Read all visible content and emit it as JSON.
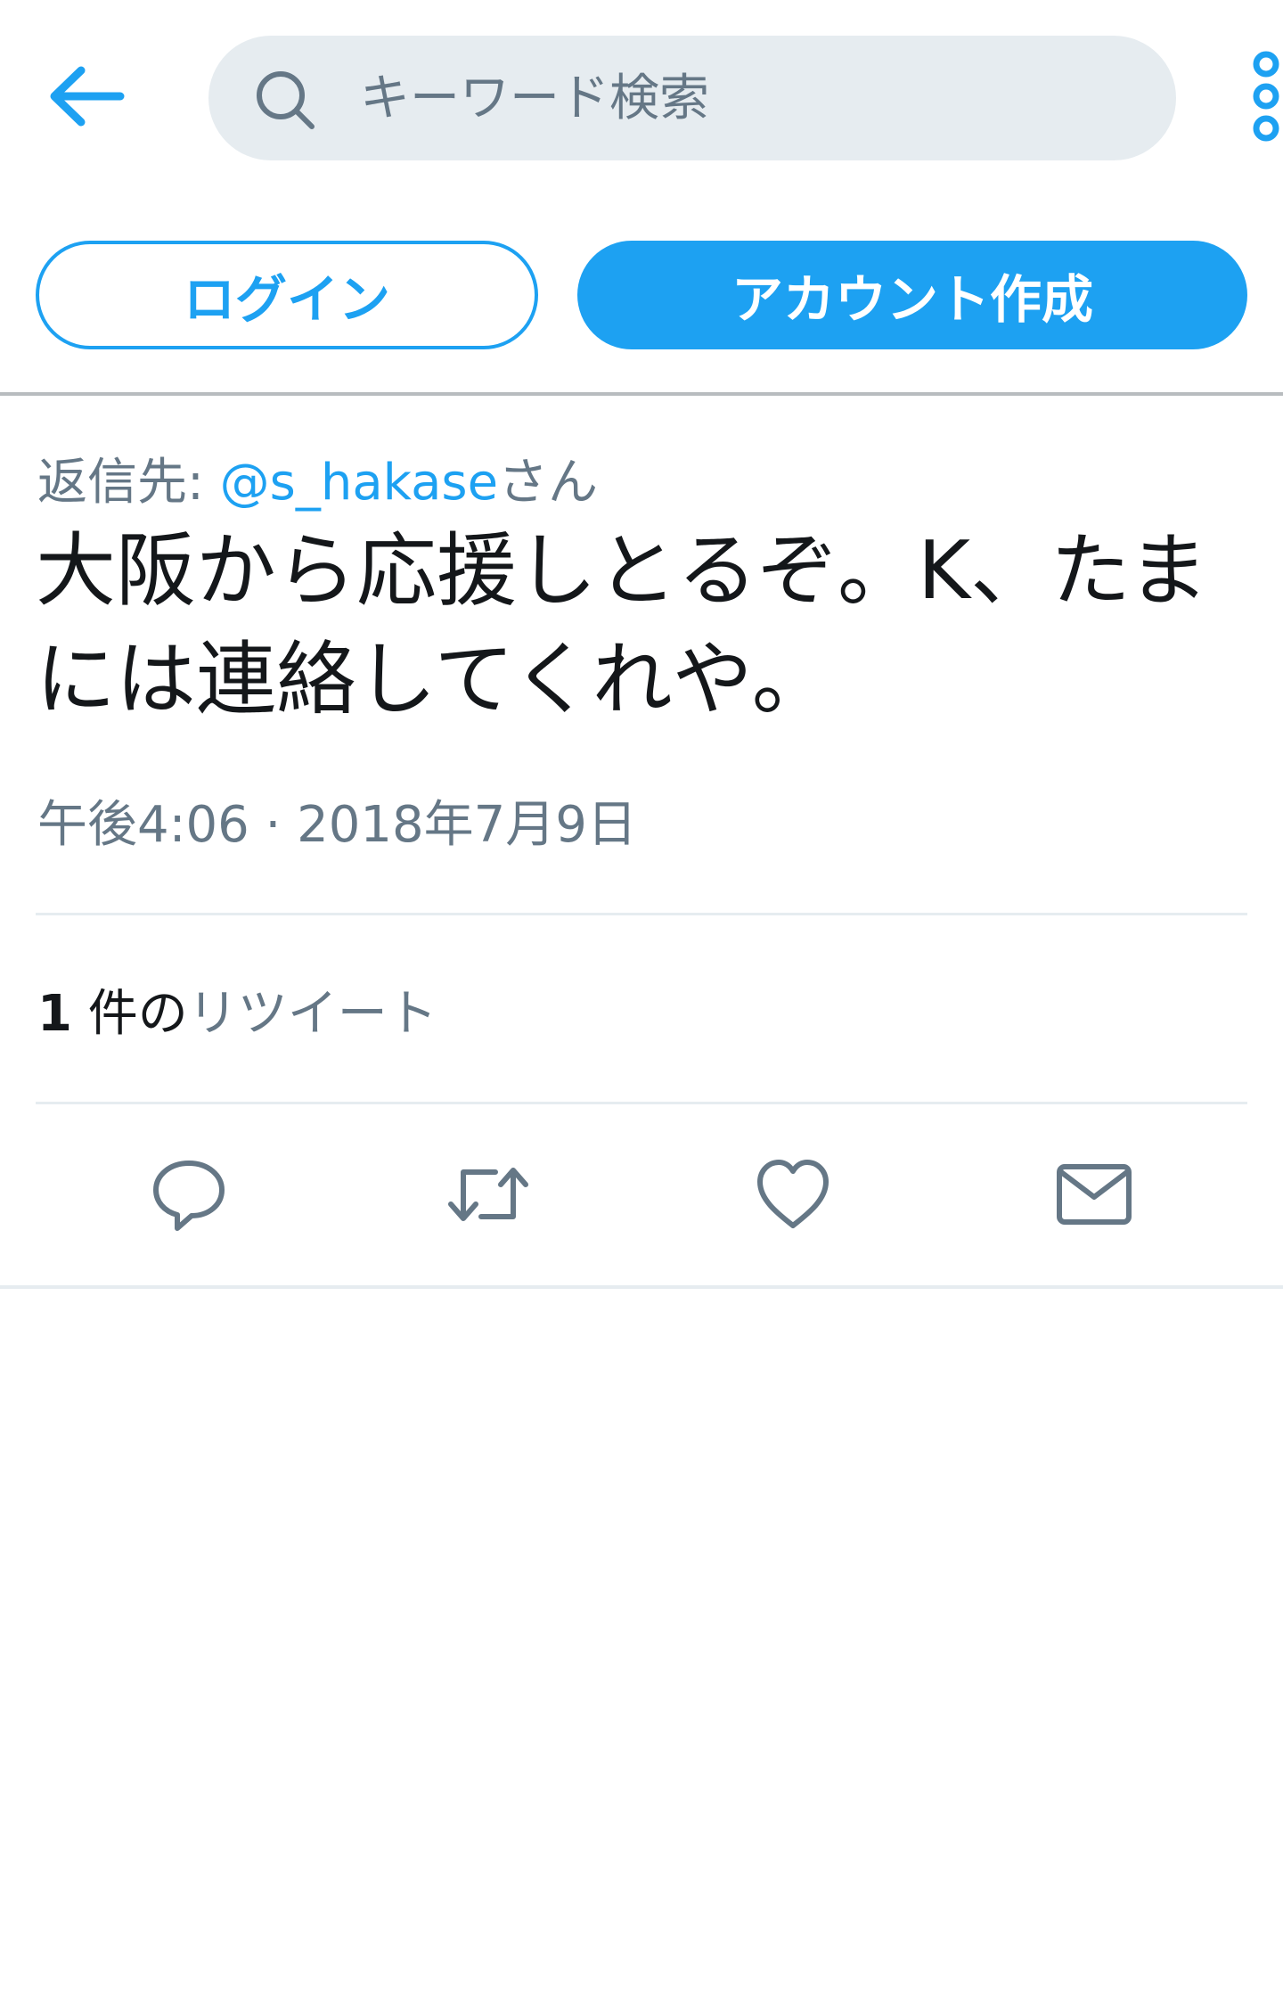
{
  "header": {
    "search": {
      "placeholder": "キーワード検索",
      "value": ""
    },
    "icons": {
      "back": "arrow-left-icon",
      "search": "search-icon",
      "more": "more-vertical-icon"
    }
  },
  "auth": {
    "login_label": "ログイン",
    "signup_label": "アカウント作成"
  },
  "tweet": {
    "reply_prefix": "返信先: ",
    "reply_handle": "@s_hakase",
    "reply_suffix": "さん",
    "text": "大阪から応援しとるぞ。K、たまには連絡してくれや。",
    "timestamp": "午後4:06 · 2018年7月9日",
    "retweet_count": "1",
    "retweet_unit": " 件の",
    "retweet_label": "リツイート"
  },
  "actions": [
    {
      "name": "reply",
      "icon": "reply-icon"
    },
    {
      "name": "retweet",
      "icon": "retweet-icon"
    },
    {
      "name": "like",
      "icon": "heart-icon"
    },
    {
      "name": "direct-message",
      "icon": "envelope-icon"
    }
  ],
  "colors": {
    "accent": "#1da1f2",
    "text_primary": "#14171a",
    "text_secondary": "#657786",
    "search_background": "#e6ecf0",
    "icon_gray": "#657786"
  }
}
